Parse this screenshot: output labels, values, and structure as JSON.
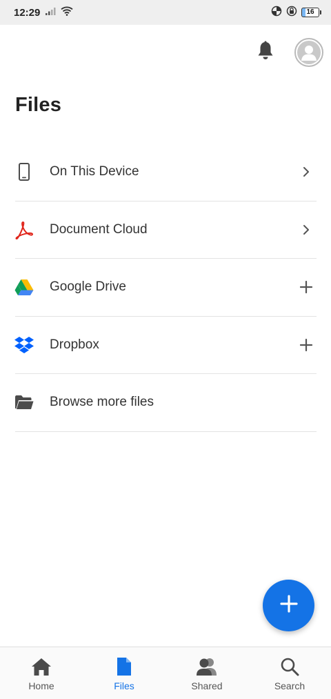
{
  "status_bar": {
    "time": "12:29",
    "battery_level": "16",
    "icons": [
      "signal-icon",
      "wifi-icon",
      "data-saver-icon",
      "vpn-lock-icon",
      "battery-icon"
    ]
  },
  "header": {
    "icons": [
      "bell-icon",
      "avatar-icon"
    ]
  },
  "page": {
    "title": "Files"
  },
  "file_list": {
    "items": [
      {
        "label": "On This Device",
        "icon": "phone-icon",
        "action": "chevron-right-icon"
      },
      {
        "label": "Document Cloud",
        "icon": "acrobat-icon",
        "action": "chevron-right-icon"
      },
      {
        "label": "Google Drive",
        "icon": "google-drive-icon",
        "action": "plus-icon"
      },
      {
        "label": "Dropbox",
        "icon": "dropbox-icon",
        "action": "plus-icon"
      },
      {
        "label": "Browse more files",
        "icon": "folder-icon",
        "action": ""
      }
    ]
  },
  "fab": {
    "icon": "plus-icon"
  },
  "bottom_nav": {
    "items": [
      {
        "label": "Home",
        "icon": "home-icon",
        "active": false
      },
      {
        "label": "Files",
        "icon": "file-icon",
        "active": true
      },
      {
        "label": "Shared",
        "icon": "people-icon",
        "active": false
      },
      {
        "label": "Search",
        "icon": "search-icon",
        "active": false
      }
    ]
  },
  "colors": {
    "accent": "#1473e6",
    "acrobat_red": "#e0251b",
    "dropbox_blue": "#0061fe",
    "icon_gray": "#4b4b4b",
    "status_bar_bg": "#efefef"
  }
}
